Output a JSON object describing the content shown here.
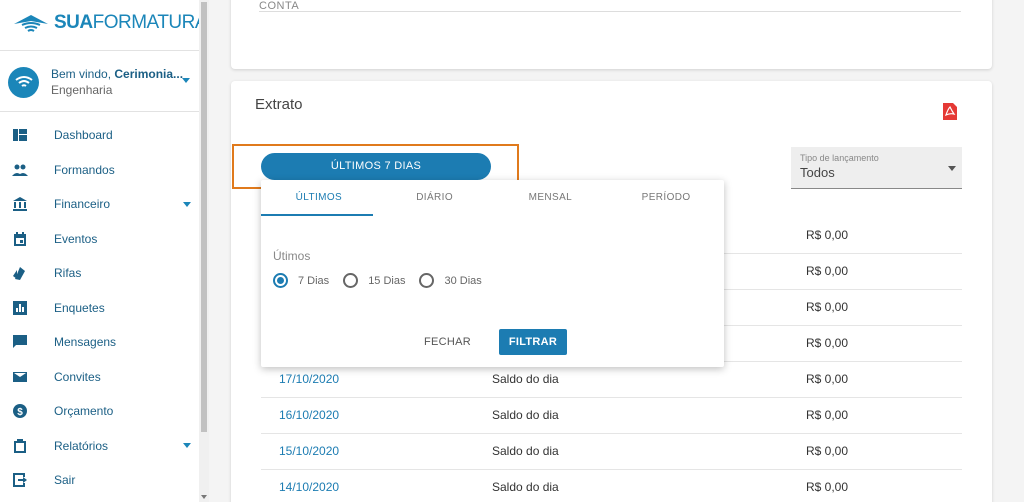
{
  "brand": {
    "logo_bold": "SUA",
    "logo_rest": "FORMATURA"
  },
  "user": {
    "welcome_prefix": "Bem vindo, ",
    "name": "Cerimonia...",
    "course": "Engenharia"
  },
  "nav": [
    {
      "label": "Dashboard",
      "icon": "dashboard-icon",
      "caret": false
    },
    {
      "label": "Formandos",
      "icon": "people-icon",
      "caret": false
    },
    {
      "label": "Financeiro",
      "icon": "bank-icon",
      "caret": true
    },
    {
      "label": "Eventos",
      "icon": "calendar-icon",
      "caret": false
    },
    {
      "label": "Rifas",
      "icon": "ticket-icon",
      "caret": false
    },
    {
      "label": "Enquetes",
      "icon": "poll-icon",
      "caret": false
    },
    {
      "label": "Mensagens",
      "icon": "chat-icon",
      "caret": false
    },
    {
      "label": "Convites",
      "icon": "mail-icon",
      "caret": false
    },
    {
      "label": "Orçamento",
      "icon": "dollar-icon",
      "caret": false
    },
    {
      "label": "Relatórios",
      "icon": "clipboard-icon",
      "caret": true
    },
    {
      "label": "Sair",
      "icon": "exit-icon",
      "caret": false
    }
  ],
  "top_card": {
    "label": "CONTA"
  },
  "extrato": {
    "title": "Extrato",
    "period_button": "ÚLTIMOS 7 DIAS",
    "select": {
      "label": "Tipo de lançamento",
      "value": "Todos"
    },
    "rows": [
      {
        "date": "",
        "desc": "",
        "amount": "R$ 0,00"
      },
      {
        "date": "",
        "desc": "",
        "amount": "R$ 0,00"
      },
      {
        "date": "",
        "desc": "",
        "amount": "R$ 0,00"
      },
      {
        "date": "",
        "desc": "",
        "amount": "R$ 0,00"
      },
      {
        "date": "17/10/2020",
        "desc": "Saldo do dia",
        "amount": "R$ 0,00"
      },
      {
        "date": "16/10/2020",
        "desc": "Saldo do dia",
        "amount": "R$ 0,00"
      },
      {
        "date": "15/10/2020",
        "desc": "Saldo do dia",
        "amount": "R$ 0,00"
      },
      {
        "date": "14/10/2020",
        "desc": "Saldo do dia",
        "amount": "R$ 0,00"
      }
    ]
  },
  "popup": {
    "tabs": [
      "ÚLTIMOS",
      "DIÁRIO",
      "MENSAL",
      "PERÍODO"
    ],
    "label": "Útimos",
    "options": [
      "7 Dias",
      "15 Dias",
      "30 Dias"
    ],
    "selected": "7 Dias",
    "close_label": "FECHAR",
    "filter_label": "FILTRAR"
  },
  "colors": {
    "primary": "#1c7cb2",
    "highlight": "#e07a1c",
    "pdf": "#e53935"
  }
}
